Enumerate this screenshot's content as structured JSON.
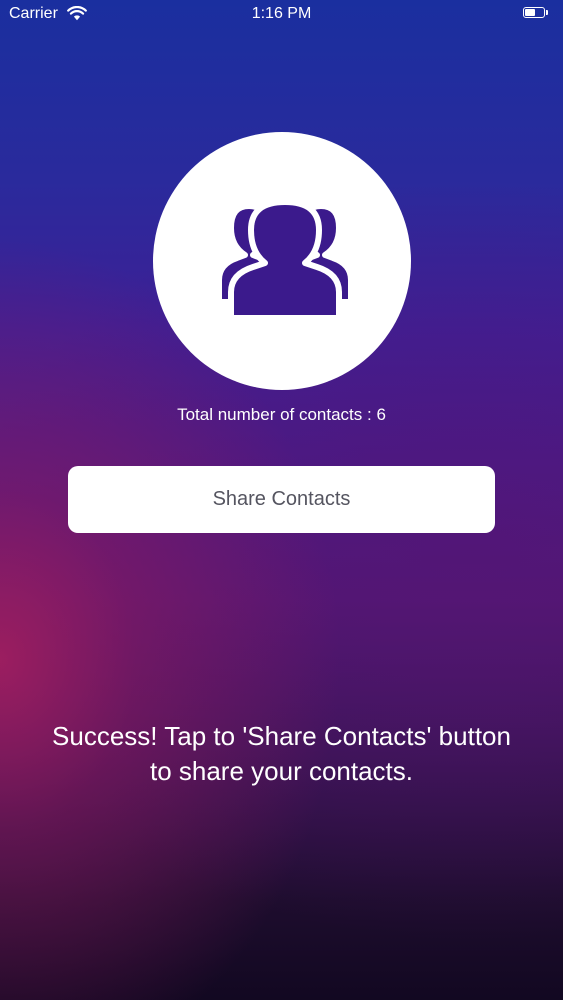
{
  "status_bar": {
    "carrier": "Carrier",
    "time": "1:16 PM",
    "battery_level": 0.55
  },
  "icons": {
    "wifi": "wifi-icon",
    "battery": "battery-icon",
    "contacts": "contacts-group-icon"
  },
  "colors": {
    "icon_color": "#3b1a8c",
    "button_text": "#555560",
    "background_top": "#1a2f9f",
    "background_bottom": "#120821",
    "background_accent": "#a01e5f"
  },
  "contacts": {
    "total_label": "Total number of contacts : 6"
  },
  "share_button": {
    "label": "Share Contacts"
  },
  "message": {
    "line1": "Success! Tap to 'Share Contacts' button",
    "line2": "to share your contacts."
  }
}
